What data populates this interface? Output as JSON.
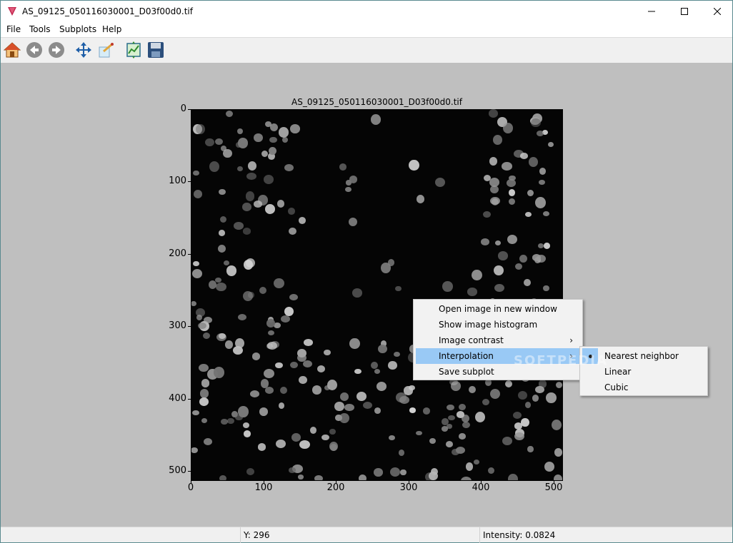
{
  "window": {
    "title": "AS_09125_050116030001_D03f00d0.tif"
  },
  "menubar": {
    "items": [
      "File",
      "Tools",
      "Subplots",
      "Help"
    ]
  },
  "toolbar": {
    "tools": [
      "home-icon",
      "back-icon",
      "forward-icon",
      "pan-icon",
      "zoom-icon",
      "configure-subplots-icon",
      "save-icon"
    ]
  },
  "plot": {
    "title": "AS_09125_050116030001_D03f00d0.tif",
    "y_ticks": [
      "0",
      "100",
      "200",
      "300",
      "400",
      "500"
    ],
    "x_ticks": [
      "0",
      "100",
      "200",
      "300",
      "400",
      "500"
    ]
  },
  "context_menu": {
    "items": [
      {
        "label": "Open image in new window"
      },
      {
        "label": "Show image histogram"
      },
      {
        "label": "Image contrast",
        "submenu": true
      },
      {
        "label": "Interpolation",
        "submenu": true,
        "highlighted": true
      },
      {
        "label": "Save subplot"
      }
    ]
  },
  "interpolation_menu": {
    "items": [
      {
        "label": "Nearest neighbor",
        "selected": true
      },
      {
        "label": "Linear"
      },
      {
        "label": "Cubic"
      }
    ]
  },
  "statusbar": {
    "x": "",
    "y": "Y: 296",
    "intensity": "Intensity: 0.0824"
  },
  "watermark": "SOFTPEDIA",
  "colors": {
    "highlight": "#99c9f5",
    "canvas_bg": "#bfbfbf",
    "image_bg": "#050505"
  }
}
